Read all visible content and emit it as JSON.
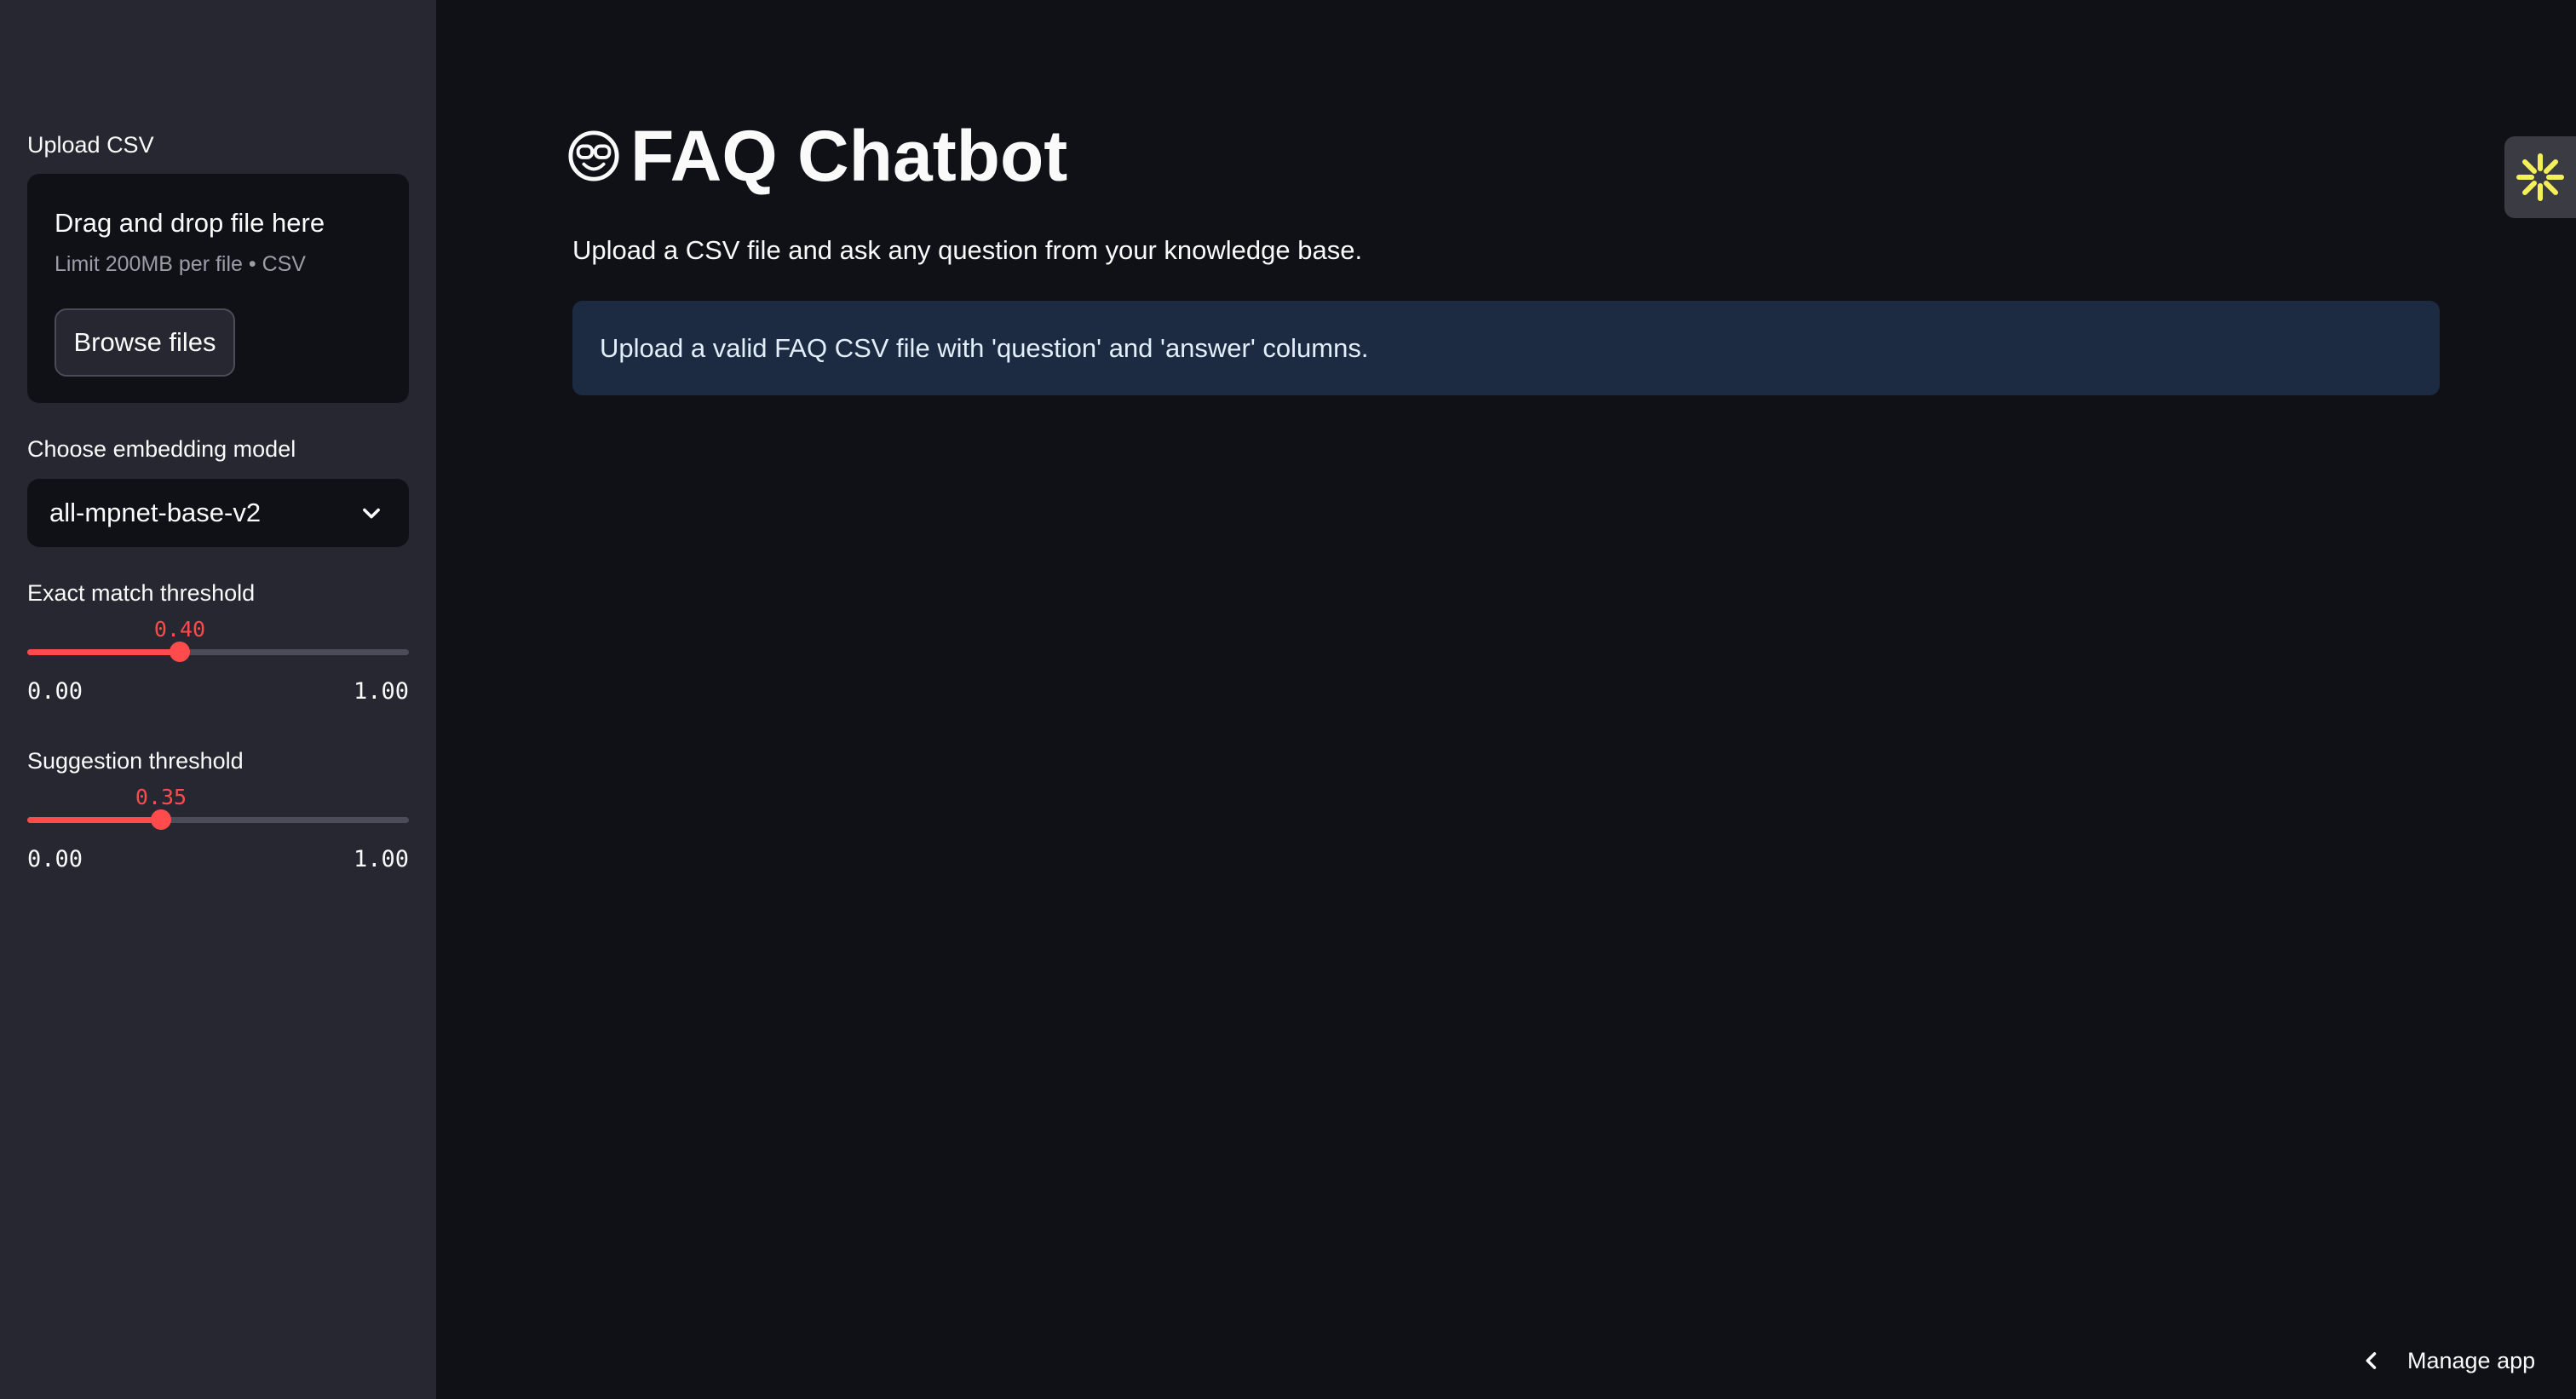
{
  "sidebar": {
    "upload": {
      "label": "Upload CSV",
      "dropzone_title": "Drag and drop file here",
      "dropzone_limit": "Limit 200MB per file • CSV",
      "browse_label": "Browse files"
    },
    "model": {
      "label": "Choose embedding model",
      "selected": "all-mpnet-base-v2"
    },
    "exact_threshold": {
      "label": "Exact match threshold",
      "value": "0.40",
      "fraction": 0.4,
      "min": "0.00",
      "max": "1.00"
    },
    "suggestion_threshold": {
      "label": "Suggestion threshold",
      "value": "0.35",
      "fraction": 0.35,
      "min": "0.00",
      "max": "1.00"
    }
  },
  "main": {
    "title": "FAQ Chatbot",
    "title_icon": "nerd-face-icon",
    "subtitle": "Upload a CSV file and ask any question from your knowledge base.",
    "info_message": "Upload a valid FAQ CSV file with 'question' and 'answer' columns."
  },
  "footer": {
    "manage_app": "Manage app"
  },
  "colors": {
    "accent": "#ff4b4b",
    "sidebar_bg": "#262730",
    "main_bg": "#0f1117",
    "info_bg": "#1c2b42",
    "status_icon": "#f4f05a"
  }
}
